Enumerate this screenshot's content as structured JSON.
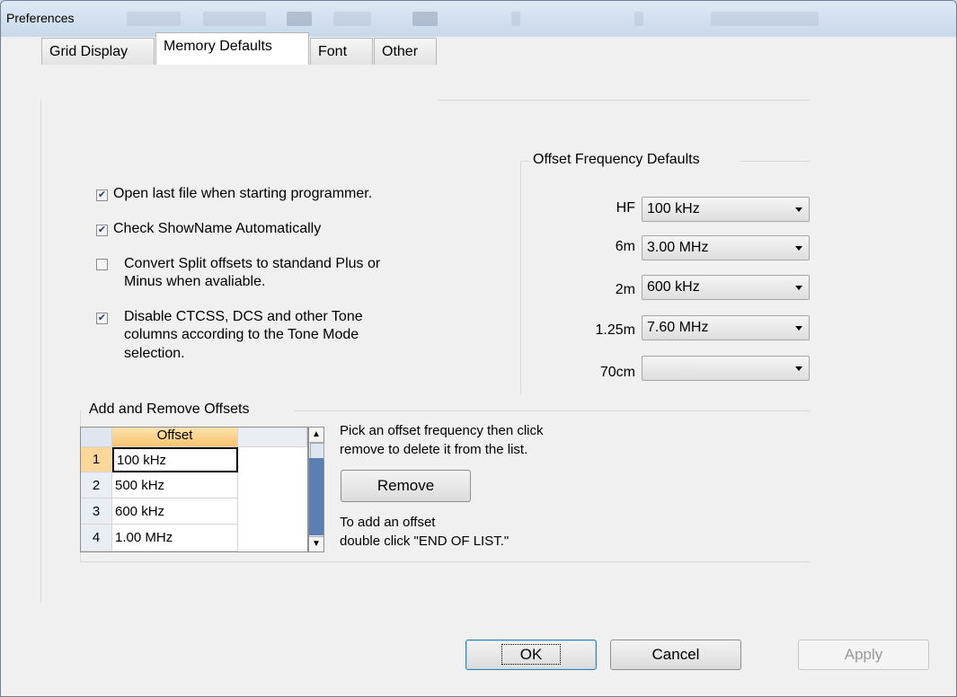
{
  "window": {
    "title": "Preferences"
  },
  "tabs": [
    {
      "label": "Grid Display"
    },
    {
      "label": "Memory Defaults"
    },
    {
      "label": "Font"
    },
    {
      "label": "Other"
    }
  ],
  "options": {
    "open_last_file": {
      "label": "Open last file when starting programmer.",
      "checked": true
    },
    "check_showname": {
      "label": "Check ShowName Automatically",
      "checked": true
    },
    "convert_split": {
      "line1": "Convert Split offsets to standand Plus or",
      "line2": "Minus when avaliable.",
      "checked": false
    },
    "disable_ctcss": {
      "line1": "Disable CTCSS, DCS and other Tone",
      "line2": "columns according to the Tone Mode",
      "line3": "selection.",
      "checked": true
    }
  },
  "offset_defaults": {
    "title": "Offset Frequency Defaults",
    "rows": [
      {
        "band": "HF",
        "value": "100 kHz"
      },
      {
        "band": "6m",
        "value": "3.00 MHz"
      },
      {
        "band": "2m",
        "value": "600 kHz"
      },
      {
        "band": "1.25m",
        "value": "7.60 MHz"
      },
      {
        "band": "70cm",
        "value": ""
      }
    ]
  },
  "add_remove": {
    "title": "Add and Remove Offsets",
    "column_header": "Offset",
    "rows": [
      {
        "num": "1",
        "value": "100 kHz"
      },
      {
        "num": "2",
        "value": "500 kHz"
      },
      {
        "num": "3",
        "value": "600 kHz"
      },
      {
        "num": "4",
        "value": "1.00 MHz"
      }
    ],
    "hint_remove_1": "Pick an offset frequency then click",
    "hint_remove_2": "remove to delete it from the list.",
    "remove_label": "Remove",
    "hint_add_1": "To add an offset",
    "hint_add_2": "double click \"END OF LIST.\""
  },
  "footer": {
    "ok": "OK",
    "cancel": "Cancel",
    "apply": "Apply"
  },
  "colors": {
    "title_bg": "#c9d8ea",
    "dialog_bg": "#f0f0f0",
    "grid_header": "#f6c46e"
  }
}
